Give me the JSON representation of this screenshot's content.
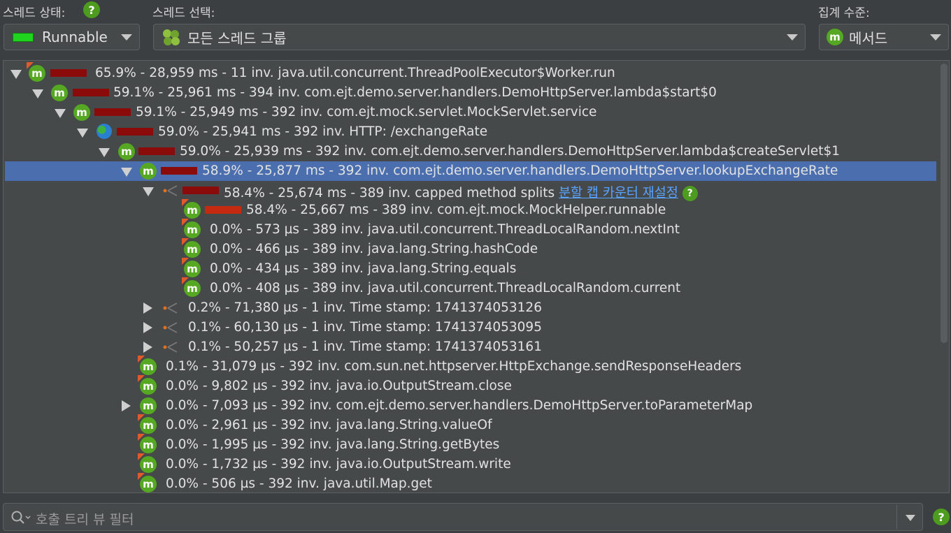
{
  "header": {
    "thread_state_label": "스레드 상태:",
    "thread_select_label": "스레드 선택:",
    "aggregation_label": "집계 수준:",
    "thread_state_value": "Runnable",
    "thread_select_value": "모든 스레드 그룹",
    "aggregation_value": "메서드",
    "help_glyph": "?"
  },
  "tree": {
    "rows": [
      {
        "text": "65.9% - 28,959 ms - 11 inv. java.util.concurrent.ThreadPoolExecutor$Worker.run",
        "icon": "method-icon"
      },
      {
        "text": "59.1% - 25,961 ms - 394 inv. com.ejt.demo.server.handlers.DemoHttpServer.lambda$start$0",
        "icon": "method-icon"
      },
      {
        "text": "59.1% - 25,949 ms - 392 inv. com.ejt.mock.servlet.MockServlet.service",
        "icon": "method-icon"
      },
      {
        "text": "59.0% - 25,941 ms - 392 inv. HTTP: /exchangeRate",
        "icon": "globe-icon"
      },
      {
        "text": "59.0% - 25,939 ms - 392 inv. com.ejt.demo.server.handlers.DemoHttpServer.lambda$createServlet$1",
        "icon": "method-icon"
      },
      {
        "text": "58.9% - 25,877 ms - 392 inv. com.ejt.demo.server.handlers.DemoHttpServer.lookupExchangeRate",
        "icon": "method-icon"
      },
      {
        "text": "58.4% - 25,674 ms - 389 inv. capped method splits",
        "icon": "split-icon",
        "link": "분할 캡 카운터 재설정"
      },
      {
        "text": "58.4% - 25,667 ms - 389 inv. com.ejt.mock.MockHelper.runnable",
        "icon": "method-icon"
      },
      {
        "text": "0.0% - 573 µs - 389 inv. java.util.concurrent.ThreadLocalRandom.nextInt",
        "icon": "method-icon"
      },
      {
        "text": "0.0% - 466 µs - 389 inv. java.lang.String.hashCode",
        "icon": "method-icon"
      },
      {
        "text": "0.0% - 434 µs - 389 inv. java.lang.String.equals",
        "icon": "method-icon"
      },
      {
        "text": "0.0% - 408 µs - 389 inv. java.util.concurrent.ThreadLocalRandom.current",
        "icon": "method-icon"
      },
      {
        "text": "0.2% - 71,380 µs - 1 inv. Time stamp: 1741374053126",
        "icon": "split-icon"
      },
      {
        "text": "0.1% - 60,130 µs - 1 inv. Time stamp: 1741374053095",
        "icon": "split-icon"
      },
      {
        "text": "0.1% - 50,257 µs - 1 inv. Time stamp: 1741374053161",
        "icon": "split-icon"
      },
      {
        "text": "0.1% - 31,079 µs - 392 inv. com.sun.net.httpserver.HttpExchange.sendResponseHeaders",
        "icon": "method-icon"
      },
      {
        "text": "0.0% - 9,802 µs - 392 inv. java.io.OutputStream.close",
        "icon": "method-icon"
      },
      {
        "text": "0.0% - 7,093 µs - 392 inv. com.ejt.demo.server.handlers.DemoHttpServer.toParameterMap",
        "icon": "method-icon"
      },
      {
        "text": "0.0% - 2,961 µs - 392 inv. java.lang.String.valueOf",
        "icon": "method-icon"
      },
      {
        "text": "0.0% - 1,995 µs - 392 inv. java.lang.String.getBytes",
        "icon": "method-icon"
      },
      {
        "text": "0.0% - 1,732 µs - 392 inv. java.io.OutputStream.write",
        "icon": "method-icon"
      },
      {
        "text": "0.0% - 506 µs - 392 inv. java.util.Map.get",
        "icon": "method-icon"
      }
    ]
  },
  "filter": {
    "placeholder": "호출 트리 뷰 필터"
  },
  "colors": {
    "selection": "#4b6eaf",
    "bar": "#8b0a0a",
    "bar_bright": "#c42a10",
    "link": "#5aa2ff",
    "method_badge": "#56a822"
  }
}
